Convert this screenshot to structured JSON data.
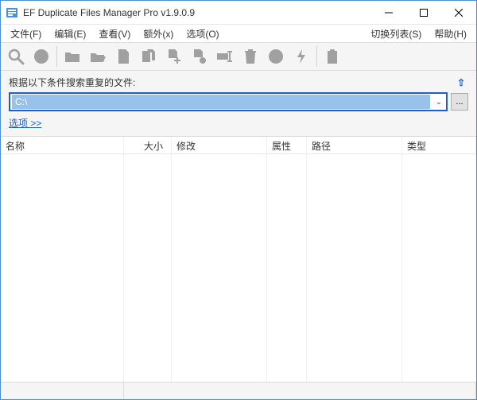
{
  "title": "EF Duplicate Files Manager Pro v1.9.0.9",
  "menu": {
    "file": "文件(F)",
    "edit": "编辑(E)",
    "view": "查看(V)",
    "extra": "额外(x)",
    "options": "选项(O)",
    "switch_list": "切换列表(S)",
    "help": "帮助(H)"
  },
  "search": {
    "label": "根据以下条件搜索重复的文件:",
    "path_value": "C:\\",
    "options_link": "选项  >>",
    "browse": "..."
  },
  "columns": {
    "name": "名称",
    "size": "大小",
    "modified": "修改",
    "attr": "属性",
    "path": "路径",
    "type": "类型"
  },
  "toolbar_icons": [
    "search",
    "circle",
    "folder",
    "folder-open",
    "file",
    "files",
    "add-file",
    "file-gear",
    "rename",
    "trash",
    "circle2",
    "bolt",
    "divider",
    "paste"
  ]
}
